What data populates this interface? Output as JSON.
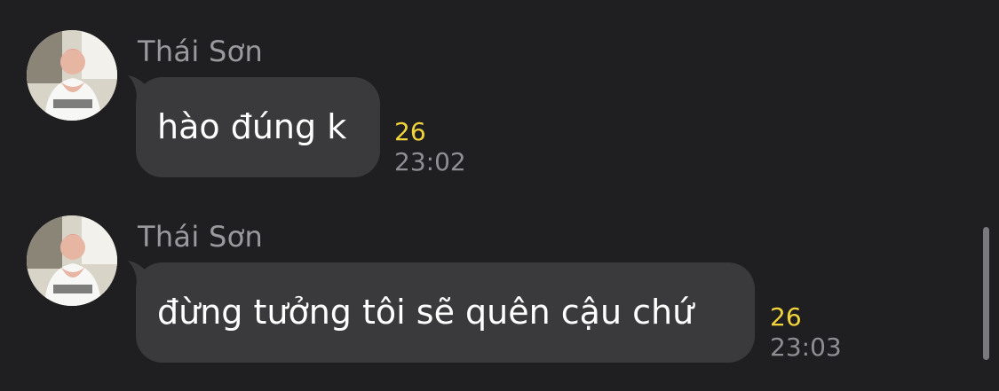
{
  "messages": [
    {
      "sender": "Thái Sơn",
      "text": "hào đúng k",
      "count": "26",
      "time": "23:02"
    },
    {
      "sender": "Thái Sơn",
      "text": "đừng tưởng tôi sẽ quên cậu chứ",
      "count": "26",
      "time": "23:03"
    }
  ],
  "colors": {
    "background": "#1f1f21",
    "bubble": "#3a3a3c",
    "count": "#f2d43b",
    "sender": "#9a9a9e",
    "time": "#8e8e93"
  },
  "icons": {
    "avatar": "user-avatar-photo"
  }
}
